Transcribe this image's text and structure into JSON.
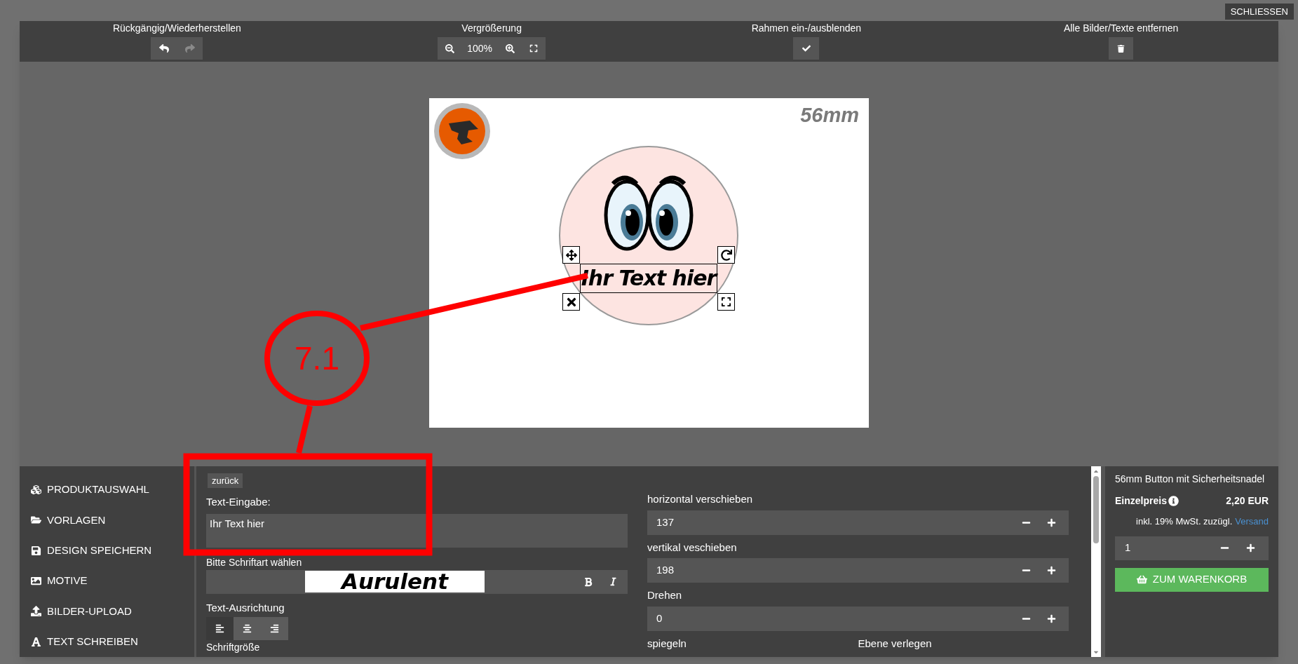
{
  "close_button": "SCHLIESSEN",
  "toolbar": [
    {
      "kind": "undo",
      "label": "Rückgängig/Wiederherstellen",
      "buttons": [
        {
          "disabled": false
        },
        {
          "disabled": true
        }
      ]
    },
    {
      "kind": "zoom",
      "label": "Vergrößerung",
      "zoom_value": "100%"
    },
    {
      "kind": "frame",
      "label": "Rahmen ein-/ausblenden"
    },
    {
      "kind": "clear",
      "label": "Alle Bilder/Texte entfernen"
    }
  ],
  "canvas": {
    "size_label": "56mm",
    "text_object": "Ihr Text hier"
  },
  "annotation": {
    "label": "7.1"
  },
  "sidebar": {
    "items": [
      {
        "label": "PRODUKTAUSWAHL"
      },
      {
        "label": "VORLAGEN"
      },
      {
        "label": "DESIGN SPEICHERN"
      },
      {
        "label": "MOTIVE"
      },
      {
        "label": "BILDER-UPLOAD"
      },
      {
        "label": "TEXT SCHREIBEN"
      }
    ]
  },
  "editor": {
    "back_button": "zurück",
    "text_label": "Text-Eingabe:",
    "text_value": "Ihr Text hier",
    "font_label": "Bitte Schriftart wählen",
    "font_name": "Aurulent",
    "align_label": "Text-Ausrichtung",
    "align_buttons": [
      {
        "selected": true
      },
      {
        "selected": false
      },
      {
        "selected": false
      }
    ],
    "size_label": "Schriftgröße",
    "steppers": [
      {
        "label": "horizontal verschieben",
        "value": "137"
      },
      {
        "label": "vertikal veschieben",
        "value": "198"
      },
      {
        "label": "Drehen",
        "value": "0"
      }
    ],
    "mirror_label": "spiegeln",
    "layer_label": "Ebene verlegen"
  },
  "product": {
    "title": "56mm Button mit Sicherheitsnadel",
    "price_label": "Einzelpreis",
    "price": "2,20 EUR",
    "tax_note": "inkl. 19% MwSt. zuzügl.",
    "shipping_link": "Versand",
    "quantity": "1",
    "cart_button": "ZUM WARENKORB"
  }
}
